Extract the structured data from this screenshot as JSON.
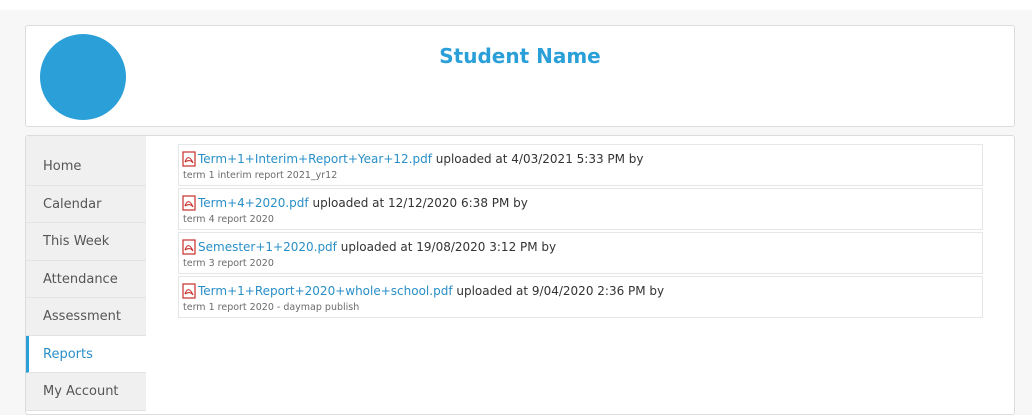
{
  "header": {
    "student_name": "Student Name"
  },
  "sidebar": {
    "items": [
      {
        "label": "Home"
      },
      {
        "label": "Calendar"
      },
      {
        "label": "This Week"
      },
      {
        "label": "Attendance"
      },
      {
        "label": "Assessment"
      },
      {
        "label": "Reports",
        "active": true
      },
      {
        "label": "My Account"
      }
    ]
  },
  "reports": [
    {
      "file": "Term+1+Interim+Report+Year+12.pdf",
      "uploaded": " uploaded at 4/03/2021 5:33 PM by",
      "description": "term 1 interim report 2021_yr12"
    },
    {
      "file": "Term+4+2020.pdf",
      "uploaded": " uploaded at 12/12/2020 6:38 PM by",
      "description": "term 4 report 2020"
    },
    {
      "file": "Semester+1+2020.pdf",
      "uploaded": " uploaded at 19/08/2020 3:12 PM by",
      "description": "term 3 report 2020"
    },
    {
      "file": "Term+1+Report+2020+whole+school.pdf",
      "uploaded": " uploaded at 9/04/2020 2:36 PM by",
      "description": "term 1 report 2020 - daymap publish"
    }
  ],
  "colors": {
    "accent": "#2a9fd8",
    "link": "#2a8fc7",
    "pdf_icon": "#c9302c"
  },
  "icons": {
    "file_type": "pdf-icon"
  }
}
